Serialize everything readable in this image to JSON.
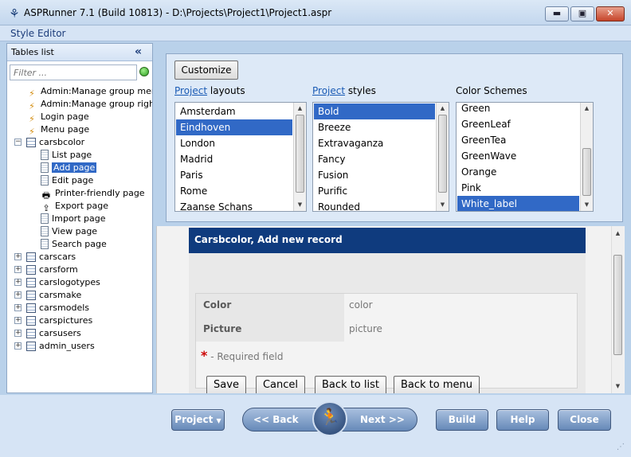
{
  "window": {
    "title": "ASPRunner 7.1 (Build 10813) - D:\\Projects\\Project1\\Project1.aspr",
    "minimize": "▬",
    "maximize": "▣",
    "close": "✕"
  },
  "menu": {
    "style_editor": "Style Editor"
  },
  "tables_panel": {
    "title": "Tables list",
    "collapse": "«",
    "filter_placeholder": "Filter ...",
    "tree": [
      {
        "label": "Admin:Manage group membe",
        "icon": "lightning-icon",
        "level": 1
      },
      {
        "label": "Admin:Manage group rights",
        "icon": "lightning-icon",
        "level": 1
      },
      {
        "label": "Login page",
        "icon": "lightning-icon",
        "level": 1
      },
      {
        "label": "Menu page",
        "icon": "lightning-icon",
        "level": 1
      },
      {
        "label": "carsbcolor",
        "icon": "table-icon",
        "level": 1,
        "expander": "−"
      },
      {
        "label": "List page",
        "icon": "page-icon",
        "level": 2
      },
      {
        "label": "Add page",
        "icon": "add-page-icon",
        "level": 2,
        "selected": true
      },
      {
        "label": "Edit page",
        "icon": "edit-page-icon",
        "level": 2
      },
      {
        "label": "Printer-friendly page",
        "icon": "printer-icon",
        "level": 2
      },
      {
        "label": "Export page",
        "icon": "export-icon",
        "level": 2
      },
      {
        "label": "Import page",
        "icon": "import-icon",
        "level": 2
      },
      {
        "label": "View page",
        "icon": "view-page-icon",
        "level": 2
      },
      {
        "label": "Search page",
        "icon": "search-page-icon",
        "level": 2
      },
      {
        "label": "carscars",
        "icon": "table-icon",
        "level": 1,
        "expander": "+"
      },
      {
        "label": "carsform",
        "icon": "table-icon",
        "level": 1,
        "expander": "+"
      },
      {
        "label": "carslogotypes",
        "icon": "table-icon",
        "level": 1,
        "expander": "+"
      },
      {
        "label": "carsmake",
        "icon": "table-icon",
        "level": 1,
        "expander": "+"
      },
      {
        "label": "carsmodels",
        "icon": "table-icon",
        "level": 1,
        "expander": "+"
      },
      {
        "label": "carspictures",
        "icon": "table-icon",
        "level": 1,
        "expander": "+"
      },
      {
        "label": "carsusers",
        "icon": "table-icon",
        "level": 1,
        "expander": "+"
      },
      {
        "label": "admin_users",
        "icon": "table-icon",
        "level": 1,
        "expander": "+"
      }
    ]
  },
  "style_panel": {
    "customize": "Customize",
    "layouts_link": "Project",
    "layouts_text": " layouts",
    "styles_link": "Project",
    "styles_text": " styles",
    "schemes_label": "Color Schemes",
    "layouts": [
      "Amsterdam",
      "Eindhoven",
      "London",
      "Madrid",
      "Paris",
      "Rome",
      "Zaanse Schans"
    ],
    "layouts_selected": 1,
    "styles": [
      "Bold",
      "Breeze",
      "Extravaganza",
      "Fancy",
      "Fusion",
      "Purific",
      "Rounded"
    ],
    "styles_selected": 0,
    "schemes": [
      "Green",
      "GreenLeaf",
      "GreenTea",
      "GreenWave",
      "Orange",
      "Pink",
      "White_label"
    ],
    "schemes_selected": 6
  },
  "preview": {
    "header": "Carsbcolor, Add new record",
    "fields": [
      {
        "label": "Color",
        "value": "color"
      },
      {
        "label": "Picture",
        "value": "picture"
      }
    ],
    "required_mark": "*",
    "required_text": " - Required field",
    "buttons": [
      "Save",
      "Cancel",
      "Back to list",
      "Back to menu"
    ]
  },
  "nav": {
    "project": "Project",
    "back": "<< Back",
    "next": "Next >>",
    "build": "Build",
    "help": "Help",
    "close": "Close"
  }
}
